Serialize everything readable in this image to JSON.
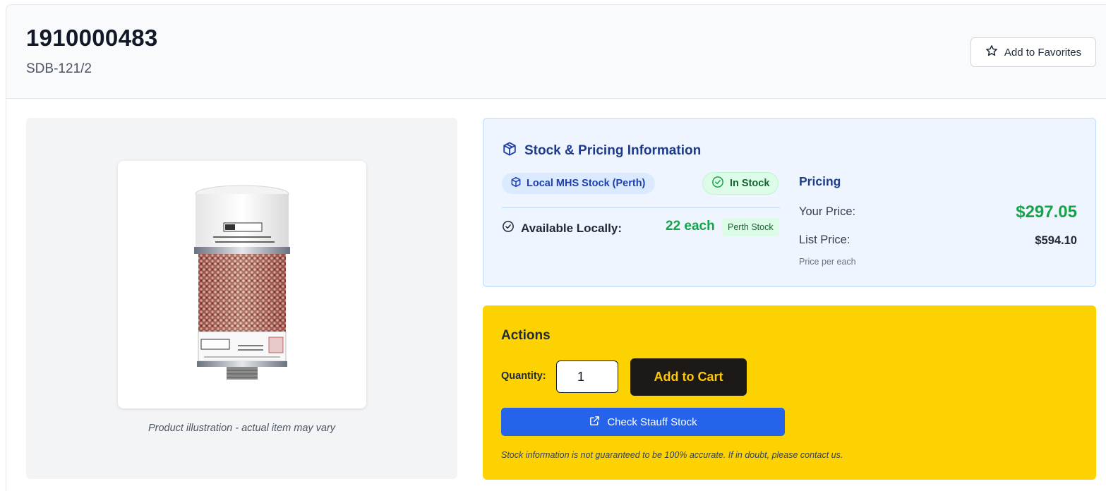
{
  "header": {
    "part_number": "1910000483",
    "part_code": "SDB-121/2",
    "favorite_label": "Add to Favorites"
  },
  "image": {
    "caption": "Product illustration - actual item may vary"
  },
  "stock": {
    "title": "Stock & Pricing Information",
    "location_badge": "Local MHS Stock (Perth)",
    "status_badge": "In Stock",
    "available_label": "Available Locally:",
    "available_qty": "22 each",
    "location_tag": "Perth Stock"
  },
  "pricing": {
    "title": "Pricing",
    "your_price_label": "Your Price:",
    "your_price": "$297.05",
    "list_price_label": "List Price:",
    "list_price": "$594.10",
    "unit_note": "Price per each"
  },
  "actions": {
    "title": "Actions",
    "quantity_label": "Quantity:",
    "quantity_value": "1",
    "add_to_cart_label": "Add to Cart",
    "check_stock_label": "Check Stauff Stock",
    "disclaimer": "Stock information is not guaranteed to be 100% accurate. If in doubt, please contact us."
  },
  "colors": {
    "accent_blue": "#2563eb",
    "price_green": "#16a34a",
    "actions_yellow": "#fdd203",
    "cart_dark": "#1c1917"
  }
}
